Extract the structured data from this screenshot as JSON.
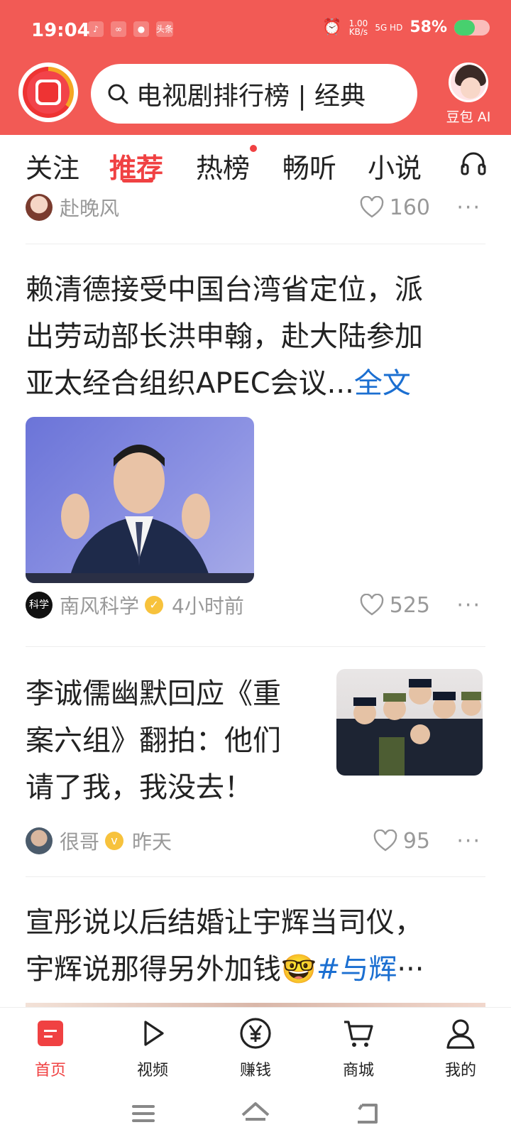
{
  "status_bar": {
    "time": "19:04",
    "app_badge": "头条",
    "net_speed_value": "1.00",
    "net_speed_unit": "KB/s",
    "signal": "5G HD",
    "battery_pct": "58%",
    "battery_level": 0.58
  },
  "header": {
    "search_query": "电视剧排行榜 | 经典",
    "ai_label": "豆包 AI"
  },
  "tabs": [
    {
      "label": "关注",
      "active": false
    },
    {
      "label": "推荐",
      "active": true
    },
    {
      "label": "热榜",
      "active": false,
      "dot": true
    },
    {
      "label": "畅听",
      "active": false
    },
    {
      "label": "小说",
      "active": false
    }
  ],
  "feed": {
    "item0": {
      "author": "赴晚风",
      "likes": "160",
      "more": "···"
    },
    "item1": {
      "title_lines": [
        "赖清德接受中国台湾省定位，派",
        "出劳动部长洪申翰，赴大陆参加",
        "亚太经合组织APEC会议..."
      ],
      "full_text_link": "全文",
      "author": "南风科学",
      "author_badge": "科学",
      "time": "4小时前",
      "likes": "525",
      "more": "···"
    },
    "item2": {
      "title_lines": [
        "李诚儒幽默回应《重",
        "案六组》翻拍：他们",
        "请了我，我没去！"
      ],
      "author": "很哥",
      "time": "昨天",
      "likes": "95",
      "more": "···"
    },
    "item3": {
      "title_line1": "宣彤说以后结婚让宇辉当司仪，",
      "title_line2_text": "宇辉说那得另外加钱🤓",
      "title_line2_tag": "#与辉",
      "title_line2_ellipsis": "···"
    }
  },
  "bottom_nav": [
    {
      "label": "首页",
      "icon": "home-icon",
      "active": true
    },
    {
      "label": "视频",
      "icon": "play-icon",
      "active": false
    },
    {
      "label": "赚钱",
      "icon": "yen-icon",
      "active": false
    },
    {
      "label": "商城",
      "icon": "cart-icon",
      "active": false
    },
    {
      "label": "我的",
      "icon": "user-icon",
      "active": false
    }
  ],
  "colors": {
    "accent": "#f04142",
    "header_bg": "#f25a55",
    "link_blue": "#1b6fd1"
  }
}
